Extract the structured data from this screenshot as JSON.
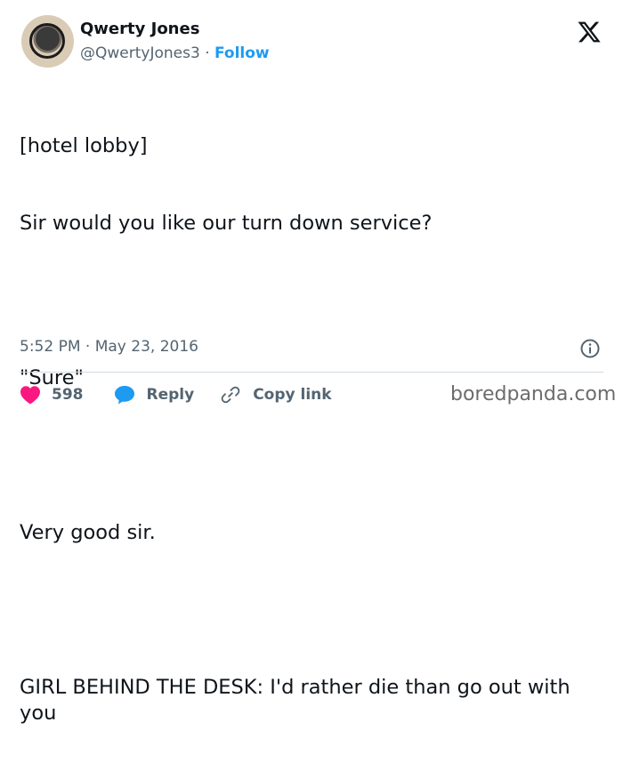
{
  "author": {
    "name": "Qwerty Jones",
    "handle": "@QwertyJones3",
    "separator": "·",
    "follow_label": "Follow"
  },
  "platform_icon": "x-logo-icon",
  "tweet": {
    "lines": [
      "[hotel lobby]",
      "Sir would you like our turn down service?",
      "",
      "\"Sure\"",
      "",
      "Very good sir.",
      "",
      "GIRL BEHIND THE DESK: I'd rather die than go out with you"
    ]
  },
  "meta": {
    "time": "5:52 PM",
    "separator": "·",
    "date": "May 23, 2016",
    "info_icon": "info-icon"
  },
  "actions": {
    "like_count": "598",
    "reply_label": "Reply",
    "copy_label": "Copy link"
  },
  "watermark": "boredpanda.com",
  "colors": {
    "accent": "#1d9bf0",
    "like": "#f91880",
    "text": "#0f1419",
    "muted": "#536471"
  }
}
